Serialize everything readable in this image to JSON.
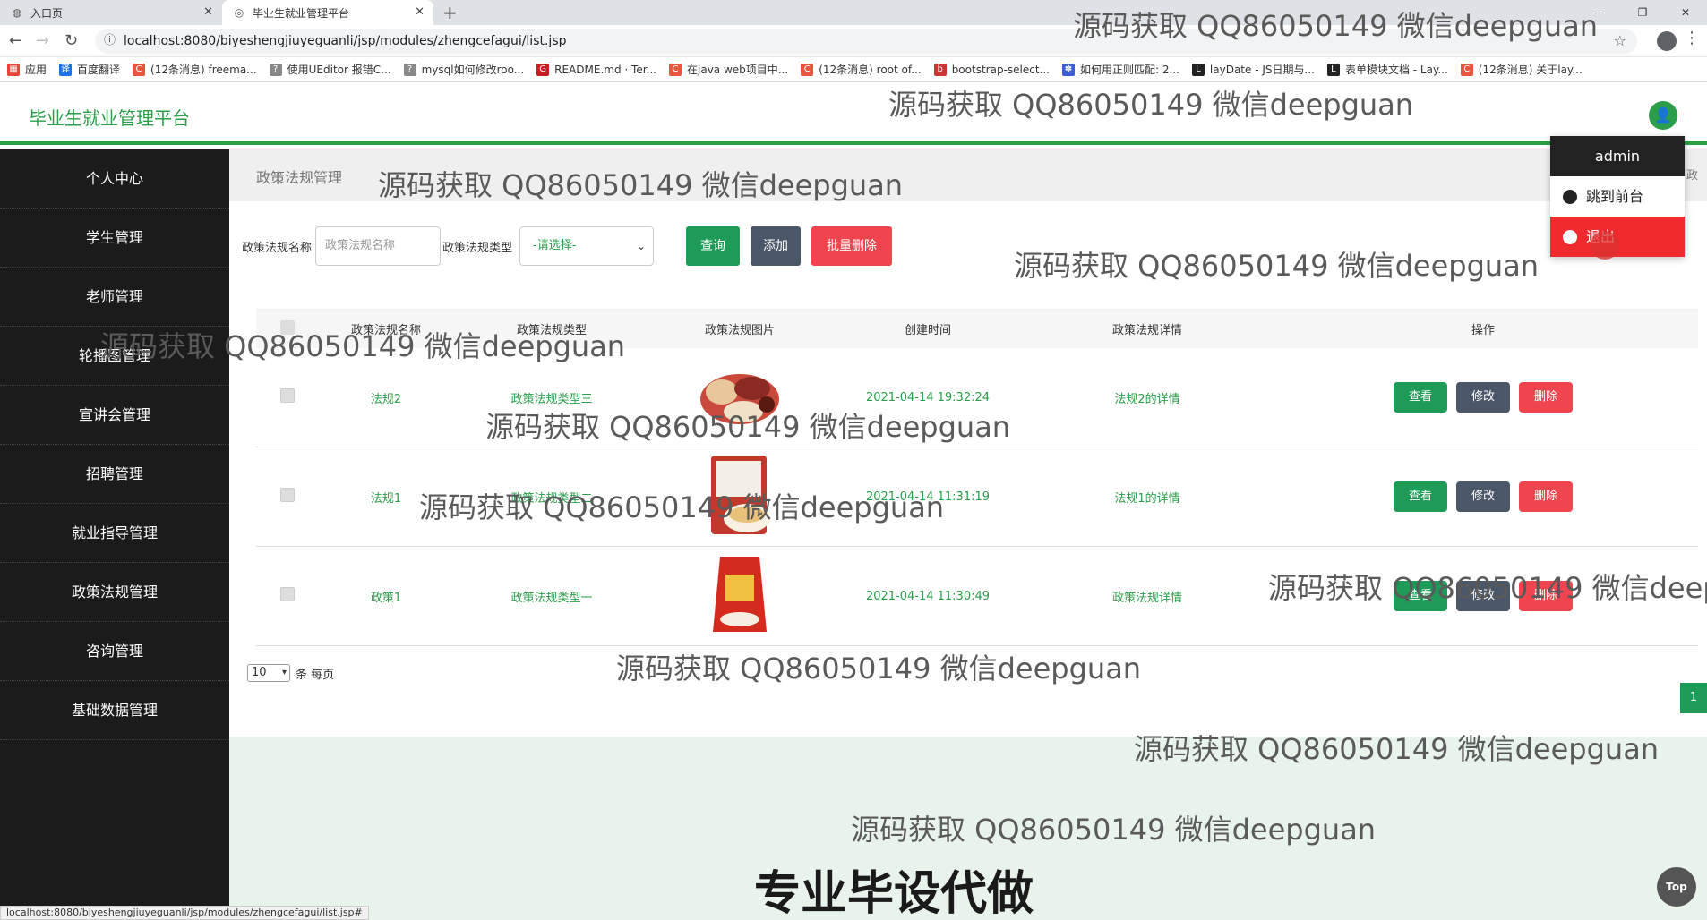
{
  "browser": {
    "tabs": [
      {
        "title": "入口页"
      },
      {
        "title": "毕业生就业管理平台"
      }
    ],
    "url": "localhost:8080/biyeshengjiuyeguanli/jsp/modules/zhengcefagui/list.jsp",
    "bookmarks": [
      "应用",
      "百度翻译",
      "(12条消息) freema...",
      "使用UEditor 报错C...",
      "mysql如何修改roo...",
      "README.md · Ter...",
      "在java web项目中...",
      "(12条消息) root of...",
      "bootstrap-select...",
      "如何用正则匹配: 2...",
      "layDate - JS日期与...",
      "表单模块文档 - Lay...",
      "(12条消息) 关于lay..."
    ],
    "status_url": "localhost:8080/biyeshengjiuyeguanli/jsp/modules/zhengcefagui/list.jsp#"
  },
  "header": {
    "brand": "毕业生就业管理平台"
  },
  "sidebar": {
    "items": [
      "个人中心",
      "学生管理",
      "老师管理",
      "轮播图管理",
      "宣讲会管理",
      "招聘管理",
      "就业指导管理",
      "政策法规管理",
      "咨询管理",
      "基础数据管理"
    ]
  },
  "page": {
    "title": "政策法规管理",
    "breadcrumb": "/ 政"
  },
  "search": {
    "name_label": "政策法规名称",
    "name_placeholder": "政策法规名称",
    "type_label": "政策法规类型",
    "type_selected": "-请选择-",
    "query_btn": "查询",
    "add_btn": "添加",
    "batch_delete_btn": "批量删除"
  },
  "table": {
    "headers": [
      "政策法规名称",
      "政策法规类型",
      "政策法规图片",
      "创建时间",
      "政策法规详情",
      "操作"
    ],
    "rows": [
      {
        "name": "法规2",
        "type": "政策法规类型三",
        "time": "2021-04-14 19:32:24",
        "detail": "法规2的详情"
      },
      {
        "name": "法规1",
        "type": "政策法规类型二",
        "time": "2021-04-14 11:31:19",
        "detail": "法规1的详情"
      },
      {
        "name": "政策1",
        "type": "政策法规类型一",
        "time": "2021-04-14 11:30:49",
        "detail": "政策法规详情"
      }
    ],
    "ops": {
      "view": "查看",
      "edit": "修改",
      "delete": "删除"
    }
  },
  "pager": {
    "page_size": "10",
    "per_page_text": "条 每页",
    "current_page": "1"
  },
  "top_btn": "Top",
  "dropdown": {
    "user": "admin",
    "to_front": "跳到前台",
    "logout": "退出"
  },
  "watermark": "源码获取 QQ86050149 微信deepguan",
  "promo": "专业毕设代做",
  "colors": {
    "brand_green": "#2a9e49",
    "btn_green": "#1e9b56",
    "btn_dark": "#4a5768",
    "btn_red": "#f0454f",
    "sidebar_bg": "#1b1b1b"
  }
}
